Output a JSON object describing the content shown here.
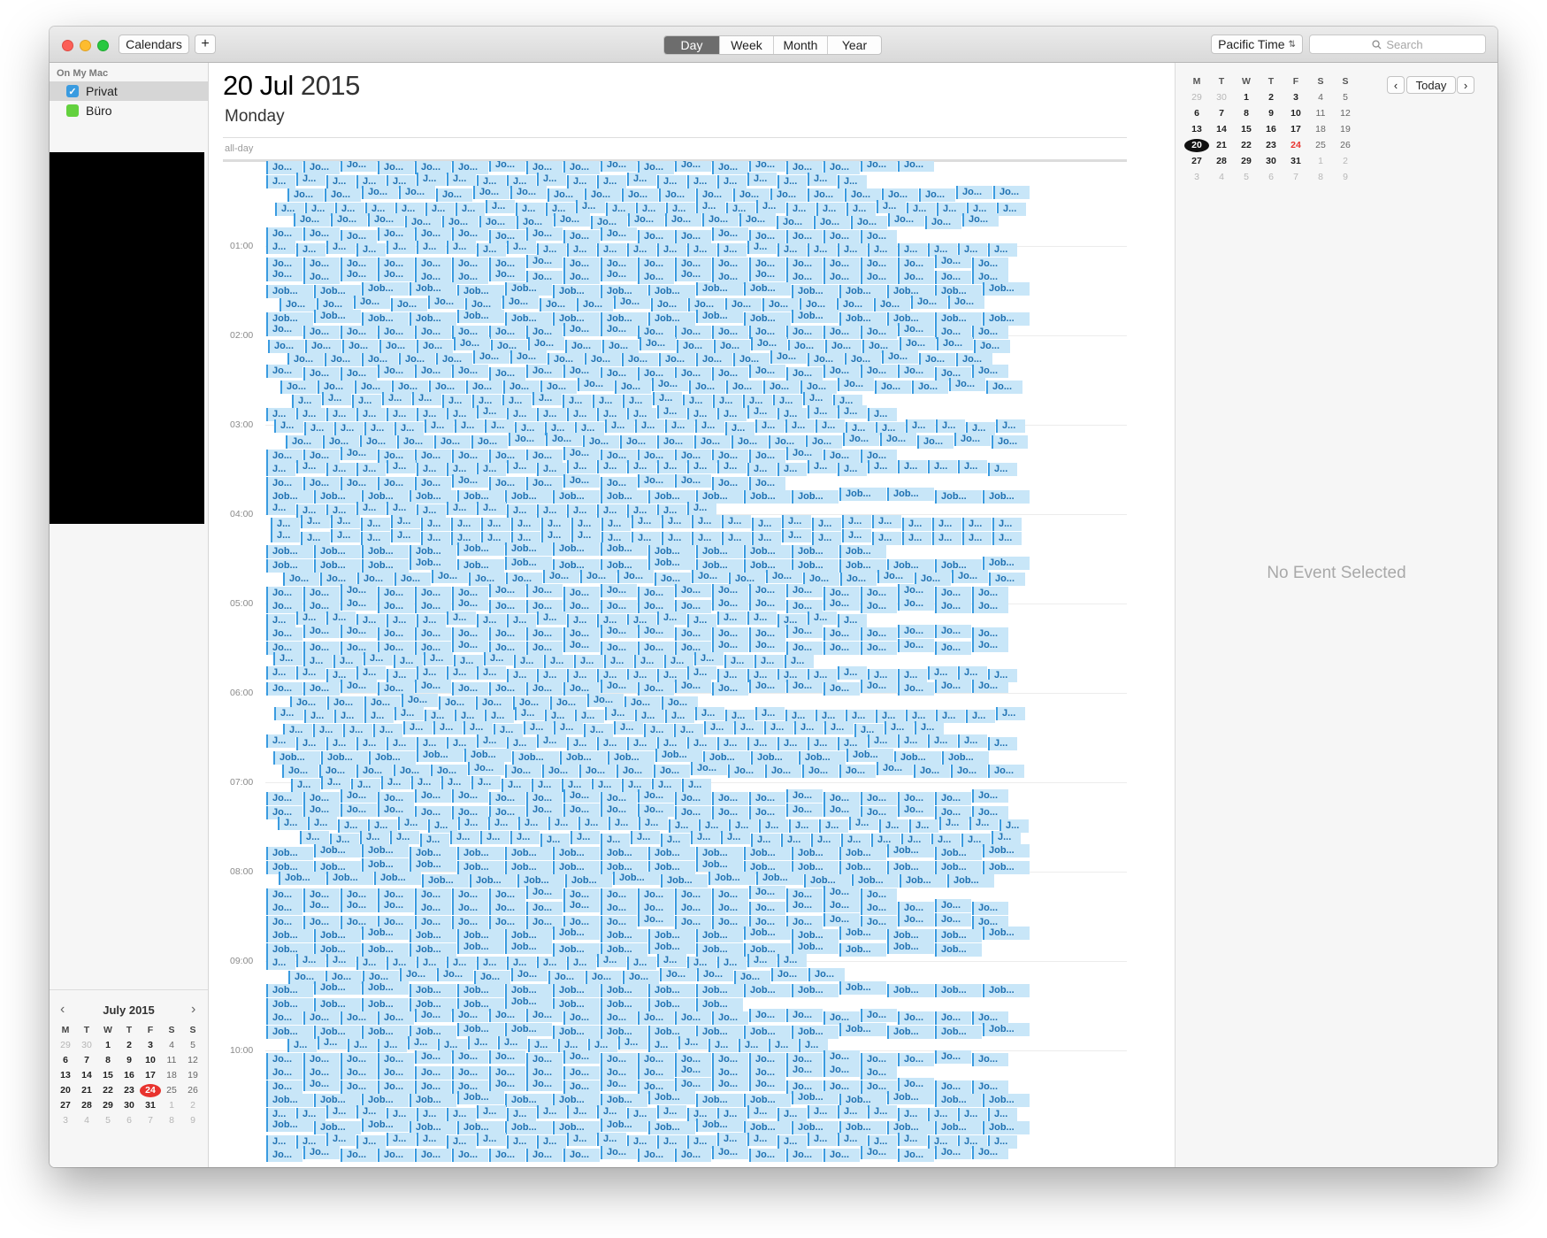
{
  "toolbar": {
    "calendars_label": "Calendars",
    "add_icon": "plus-icon",
    "views": [
      "Day",
      "Week",
      "Month",
      "Year"
    ],
    "active_view": "Day",
    "timezone": "Pacific Time",
    "timezone_icon": "updown-chevron-icon",
    "search_placeholder": "Search",
    "search_icon": "search-icon"
  },
  "sidebar": {
    "section": "On My Mac",
    "calendars": [
      {
        "label": "Privat",
        "color": "#3a9be0",
        "checked": true
      },
      {
        "label": "Büro",
        "color": "#63d13e",
        "checked": false
      }
    ],
    "minical": {
      "title": "July 2015",
      "weekdays": [
        "M",
        "T",
        "W",
        "T",
        "F",
        "S",
        "S"
      ],
      "weeks": [
        [
          "29",
          "30",
          "1",
          "2",
          "3",
          "4",
          "5"
        ],
        [
          "6",
          "7",
          "8",
          "9",
          "10",
          "11",
          "12"
        ],
        [
          "13",
          "14",
          "15",
          "16",
          "17",
          "18",
          "19"
        ],
        [
          "20",
          "21",
          "22",
          "23",
          "24",
          "25",
          "26"
        ],
        [
          "27",
          "28",
          "29",
          "30",
          "31",
          "1",
          "2"
        ],
        [
          "3",
          "4",
          "5",
          "6",
          "7",
          "8",
          "9"
        ]
      ],
      "today": "24"
    }
  },
  "day_view": {
    "date": "20 Jul",
    "year": "2015",
    "weekday": "Monday",
    "allday_label": "all-day",
    "hours": [
      "01:00",
      "02:00",
      "03:00",
      "04:00",
      "05:00",
      "06:00",
      "07:00",
      "08:00",
      "09:00",
      "10:00"
    ],
    "event_colors": {
      "fill": "#c8e6f8",
      "border": "#3a9be0",
      "text": "#1d6fb0"
    },
    "event_label_long": "Job...",
    "event_label_mid": "Jo...",
    "event_label_short": "J..."
  },
  "inspector": {
    "weekdays": [
      "M",
      "T",
      "W",
      "T",
      "F",
      "S",
      "S"
    ],
    "weeks": [
      [
        "29",
        "30",
        "1",
        "2",
        "3",
        "4",
        "5"
      ],
      [
        "6",
        "7",
        "8",
        "9",
        "10",
        "11",
        "12"
      ],
      [
        "13",
        "14",
        "15",
        "16",
        "17",
        "18",
        "19"
      ],
      [
        "20",
        "21",
        "22",
        "23",
        "24",
        "25",
        "26"
      ],
      [
        "27",
        "28",
        "29",
        "30",
        "31",
        "1",
        "2"
      ],
      [
        "3",
        "4",
        "5",
        "6",
        "7",
        "8",
        "9"
      ]
    ],
    "selected": "20",
    "highlight": "24",
    "today_label": "Today",
    "empty_message": "No Event Selected"
  }
}
